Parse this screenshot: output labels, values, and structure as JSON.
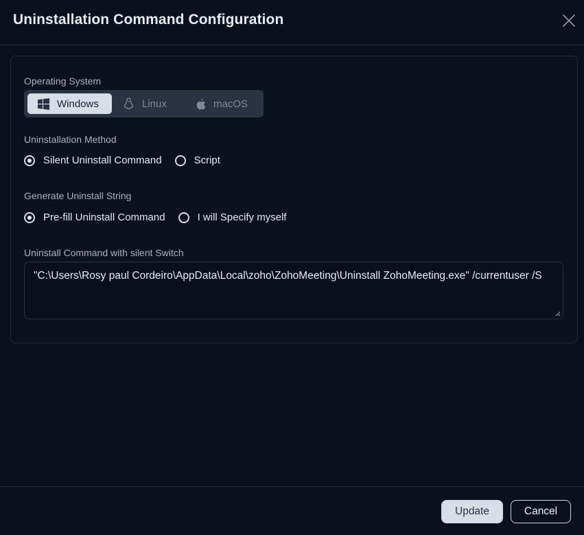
{
  "dialog": {
    "title": "Uninstallation Command Configuration"
  },
  "os": {
    "label": "Operating System",
    "options": [
      {
        "label": "Windows",
        "icon": "windows-icon",
        "selected": true
      },
      {
        "label": "Linux",
        "icon": "linux-icon",
        "selected": false
      },
      {
        "label": "macOS",
        "icon": "apple-icon",
        "selected": false
      }
    ]
  },
  "method": {
    "label": "Uninstallation Method",
    "options": [
      {
        "label": "Silent Uninstall Command",
        "selected": true
      },
      {
        "label": "Script",
        "selected": false
      }
    ]
  },
  "generate": {
    "label": "Generate Uninstall String",
    "options": [
      {
        "label": "Pre-fill Uninstall Command",
        "selected": true
      },
      {
        "label": "I will Specify myself",
        "selected": false
      }
    ]
  },
  "command": {
    "label": "Uninstall Command with silent Switch",
    "value": "\"C:\\Users\\Rosy paul Cordeiro\\AppData\\Local\\zoho\\ZohoMeeting\\Uninstall ZohoMeeting.exe\" /currentuser /S"
  },
  "footer": {
    "update_label": "Update",
    "cancel_label": "Cancel"
  },
  "colors": {
    "background": "#0a101c",
    "segment_active": "#d9dde6",
    "segment_bg": "#2a3243"
  }
}
